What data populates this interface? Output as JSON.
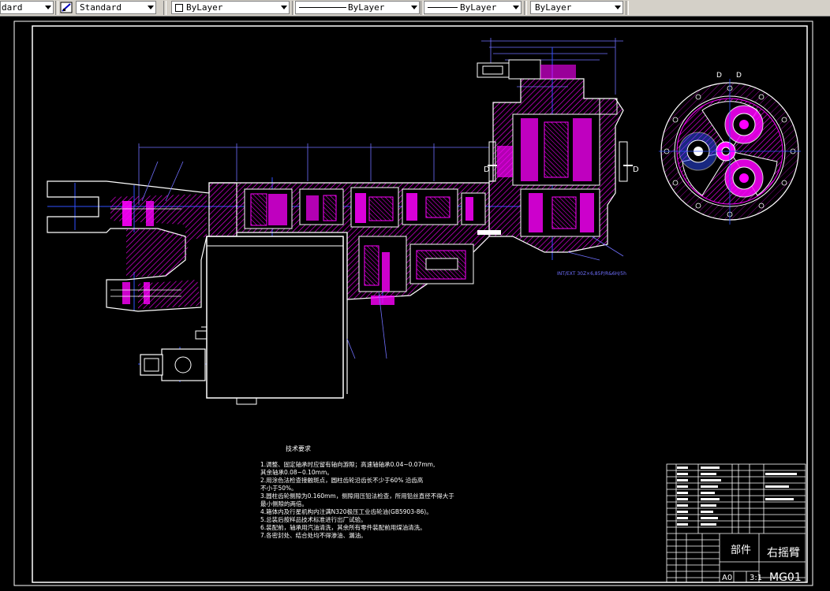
{
  "toolbar": {
    "layer_fragment": "dard",
    "text_style": "Standard",
    "color": "ByLayer",
    "linetype": "ByLayer",
    "lineweight": "ByLayer",
    "plotstyle": "ByLayer"
  },
  "drawing": {
    "tech_title": "技术要求",
    "tech_lines": [
      "1.调整、固定轴承时应留有轴向游隙；高速轴轴承0.04~0.07mm,",
      "  其余轴承0.08~0.10mm。",
      "2.用涂色法检查接触斑点，圆柱齿轮沿齿长不少于60% 沿齿高",
      "  不小于50%。",
      "3.圆柱齿轮侧隙为0.160mm，侧隙用压铅法检查，所用铅丝直径不得大于",
      "  最小侧隙的两倍。",
      "4.箱体内及行星机构内注满N320极压工业齿轮油(GB5903-86)。",
      "5.总装后按样品技术标准进行出厂试验。",
      "6.装配前，轴承用汽油清洗，其余所有零件装配前用煤油清洗。",
      "7.各密封处、结合处均不得渗油、漏油。"
    ],
    "section_labels": [
      "D",
      "D",
      "D",
      "D"
    ],
    "interface_note": "INT/EXT 30Z×6,85P/R&6H/5h",
    "title_block": {
      "part_label": "部件",
      "name": "右摇臂",
      "size": "A0",
      "scale": "3:1",
      "drawing_no": "MG01"
    }
  },
  "colors": {
    "background": "#000000",
    "outline": "#ffffff",
    "hatch": "#ff00ff",
    "centerline": "#3050ff",
    "dimension": "#7070ff"
  }
}
